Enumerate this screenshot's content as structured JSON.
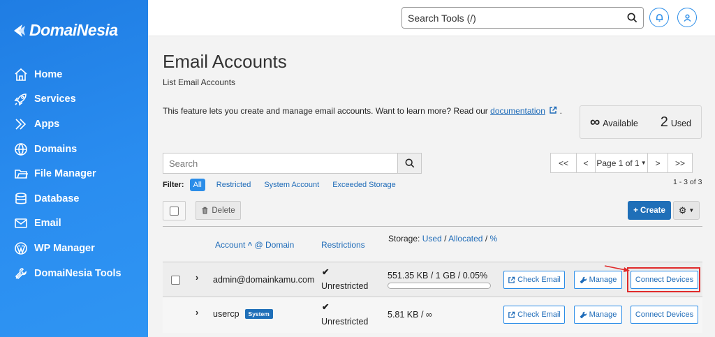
{
  "brand": {
    "name": "DomaiNesia"
  },
  "sidebar": {
    "items": [
      {
        "label": "Home",
        "icon": "home-icon"
      },
      {
        "label": "Services",
        "icon": "rocket-icon"
      },
      {
        "label": "Apps",
        "icon": "apps-icon"
      },
      {
        "label": "Domains",
        "icon": "globe-icon"
      },
      {
        "label": "File Manager",
        "icon": "folder-icon"
      },
      {
        "label": "Database",
        "icon": "database-icon"
      },
      {
        "label": "Email",
        "icon": "mail-icon"
      },
      {
        "label": "WP Manager",
        "icon": "wordpress-icon"
      },
      {
        "label": "DomaiNesia Tools",
        "icon": "tools-icon"
      }
    ]
  },
  "topbar": {
    "search_placeholder": "Search Tools (/)"
  },
  "page": {
    "title": "Email Accounts",
    "subtitle": "List Email Accounts",
    "intro_text": "This feature lets you create and manage email accounts. Want to learn more? Read our ",
    "intro_link": "documentation",
    "intro_end": "."
  },
  "stats": {
    "available_symbol": "∞",
    "available_label": "Available",
    "used_value": "2",
    "used_label": "Used"
  },
  "search": {
    "placeholder": "Search"
  },
  "pagination": {
    "first": "<<",
    "prev": "<",
    "page": "Page 1 of 1",
    "next": ">",
    "last": ">>",
    "range": "1 - 3 of 3"
  },
  "filter": {
    "label": "Filter:",
    "options": [
      "All",
      "Restricted",
      "System Account",
      "Exceeded Storage"
    ]
  },
  "toolbar": {
    "delete": "Delete",
    "create": "+ Create"
  },
  "table": {
    "col_account": "Account",
    "col_domain": "@ Domain",
    "col_restrictions": "Restrictions",
    "col_storage_prefix": "Storage:",
    "col_storage_used": "Used",
    "col_storage_sep1": "/",
    "col_storage_allocated": "Allocated",
    "col_storage_sep2": "/",
    "col_storage_pct": "%",
    "rows": [
      {
        "account": "admin@domainkamu.com",
        "restriction": "Unrestricted",
        "storage": "551.35 KB / 1 GB / 0.05%",
        "usage_fraction": 0.0005,
        "check_email": "Check Email",
        "manage": "Manage",
        "connect": "Connect Devices"
      },
      {
        "account": "usercp",
        "badge": "System",
        "restriction": "Unrestricted",
        "storage": "5.81 KB / ∞",
        "check_email": "Check Email",
        "manage": "Manage",
        "connect": "Connect Devices"
      }
    ]
  },
  "colors": {
    "sidebar": "#2a8df0",
    "primary": "#1f6fb8",
    "link": "#1e6bb8",
    "highlight": "#e02a2a"
  }
}
